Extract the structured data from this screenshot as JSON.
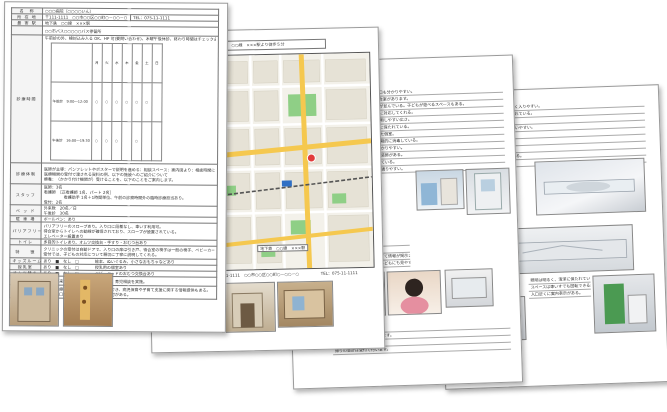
{
  "facility": {
    "name_label": "名　称",
    "name_value": "○○○病院（○○○○いん）",
    "address_label": "所 在 地",
    "address_value": "〒111-1111　○○市○○区○○町○－○○－○",
    "tel": "TEL：075-11-1111",
    "nearest_label": "最 寄 駅",
    "nearest_value": "地下鉄　○○線　×××駅",
    "other_station": "○○市バス○○○○○バス停留所",
    "hours_label": "診療時間",
    "hours_note": "午前診の外、検討込み入る OK、HP 可(要問い合わせ)、木曜午後休診、終わり時間はチェック必要。",
    "hours_table_head": [
      "",
      "月",
      "火",
      "水",
      "木",
      "金",
      "土",
      "日"
    ],
    "hours_rows": [
      {
        "label": "午前診　9:00～12:00",
        "marks": [
          "○",
          "○",
          "○",
          "○",
          "○",
          "○",
          ""
        ]
      },
      {
        "label": "午後診　16:00～19:30",
        "marks": [
          "○",
          "○",
          "○",
          "",
          "○",
          "",
          ""
        ]
      }
    ],
    "consult_label": "診療体制",
    "consult_lines": [
      "医師が主導：パンフレットやポスターで説明を進める：相談スペース：案内図より：相談時間について",
      "医療機関の受付で渡される資料の例、以下の施設へのご紹介について",
      "療養：（かかり付け機関が）受けることを、以下のことをご案内します。"
    ],
    "staff_label": "スタッフ",
    "staff_rows": [
      "医師：3名",
      "看護師　［正看護師 1名、パート 2名］",
      "　　　　　看護助手 1名＋1時間単位、午前の診察時間外の臨時診療担当あり。",
      "受付：2名"
    ],
    "beds_label": "ベ ッ ド",
    "beds_rows": [
      "外来数　20名／日",
      "午後診　30名"
    ],
    "parking_label": "駐 車 場",
    "parking_value": "ボールペン：あり",
    "barrier_label": "バリアフリー",
    "barrier_lines": [
      "バリアフリーのスロープあり。入り口に段差なし、車いす利用可。",
      "待合室からトイレへの動線が確保されており、スロープが設置されている。",
      "エレベーター設置あり"
    ],
    "toilet_label": "トイレ",
    "toilet_value": "多目的トイレあり、オムツ交換台・手すり・おむつ台あり",
    "features_label": "特　　徴",
    "features_lines": [
      "クリニックの受付は自動ドアで、入り口の扉は引き戸、待合室の椅子は一般の椅子、ベビーカー置き場あり。",
      "受付では、子どもの対応について親切に丁寧に説明してくれる。"
    ],
    "kids_label": "キッズルーム",
    "kids_value": "あり　■　なし　□　　　　絵本、ぬいぐるみ、小さなおもちゃなどあり",
    "nursing_label": "授乳室",
    "nursing_value": "あり　■　なし　□　　　　授乳用の個室あり",
    "diaper_label": "オムツ替え",
    "diaper_value": "あり　■　なし　□　　　　ベビーベッドのおむつ交換台あり",
    "events_label": "地域連携",
    "events_value": "小児科外来で、予防接種、乳幼児健診、育児相談を実施。",
    "notes_label": "備　　考",
    "notes_lines": [
      "小児の診療についても相談することができ、病児保育や子育て支援に関する情報提供もある。",
      "病院の入口を入ってすぐのところに受付がある。"
    ]
  },
  "map_page": {
    "header": "地下鉄　○○線　×××駅より徒歩５分",
    "footer_address": "〒111-1111　○○市○○区○○町○－○○－○",
    "footer_tel": "TEL：075-11-1111",
    "map_legend": "地下鉄　○○線　×××駅"
  },
  "page3": {
    "lines": [
      "病院の外観。駐車場あり、入口も分かりやすい。",
      "入口を入ってすぐ、受付と待合室があります。",
      "待合室は広く、ソファや椅子が並んでいる。子どもが遊べるスペースもある。",
      "受付の様子。スタッフが丁寧に対応してくれる。",
      "トイレの入口。車いすでも利用しやすい広さ。",
      "おむつ替えのスペース。清潔に保たれている。",
      "授乳室。カーテンで仕切られた個室。",
      "キッズルームのおもちゃ。定期的に消毒している。",
      "診察室の入口。案内表示が分かりやすい。",
      "診察室の内部。子ども向けの装飾がある。",
      "処置室。必要な器具がそろっている。",
      "廊下は広く、ベビーカーでも通りやすい。",
      "エレベーターの入口。",
      "病院の裏側の出入口。",
      "待合室の掲示板。地域の子育て情報が掲示されている。",
      "受付カウンターは低めで、子どもにも見やすい。",
      "診察室の前の待合スペース。",
      "看護師が子どもと話しています。",
      "検査室の様子。",
      "帰りの会計は受付で行います。"
    ]
  },
  "page4": {
    "lines": [
      "トイレの入口は引き戸で、段差がなく入りやすい。",
      "トイレ内部は広く、手すりが設置されている。",
      "ベビーチェアが設置されている。",
      "おむつ交換台は折りたたみ式で、使いやすい。",
      "手洗い場は低めに設置されている。",
      "洗面台の下にも空間がある。",
      "ゴミ箱はふた付き。",
      "トイレットペーパーは補充されている。",
      "非常用の呼び出しボタンがある。",
      "照明は明るく、清潔に保たれている。",
      "スペースは車いすでも回転できる広さ。",
      "入口近くに案内表示がある。",
      "授乳室の前に案内がある。",
      "授乳室の中にはソファがある。",
      "カーテンで仕切ることができる。",
      "ミルク用のお湯が準備されている。",
      "授乳室のゴミ箱。",
      "授乳室の照明。"
    ]
  }
}
